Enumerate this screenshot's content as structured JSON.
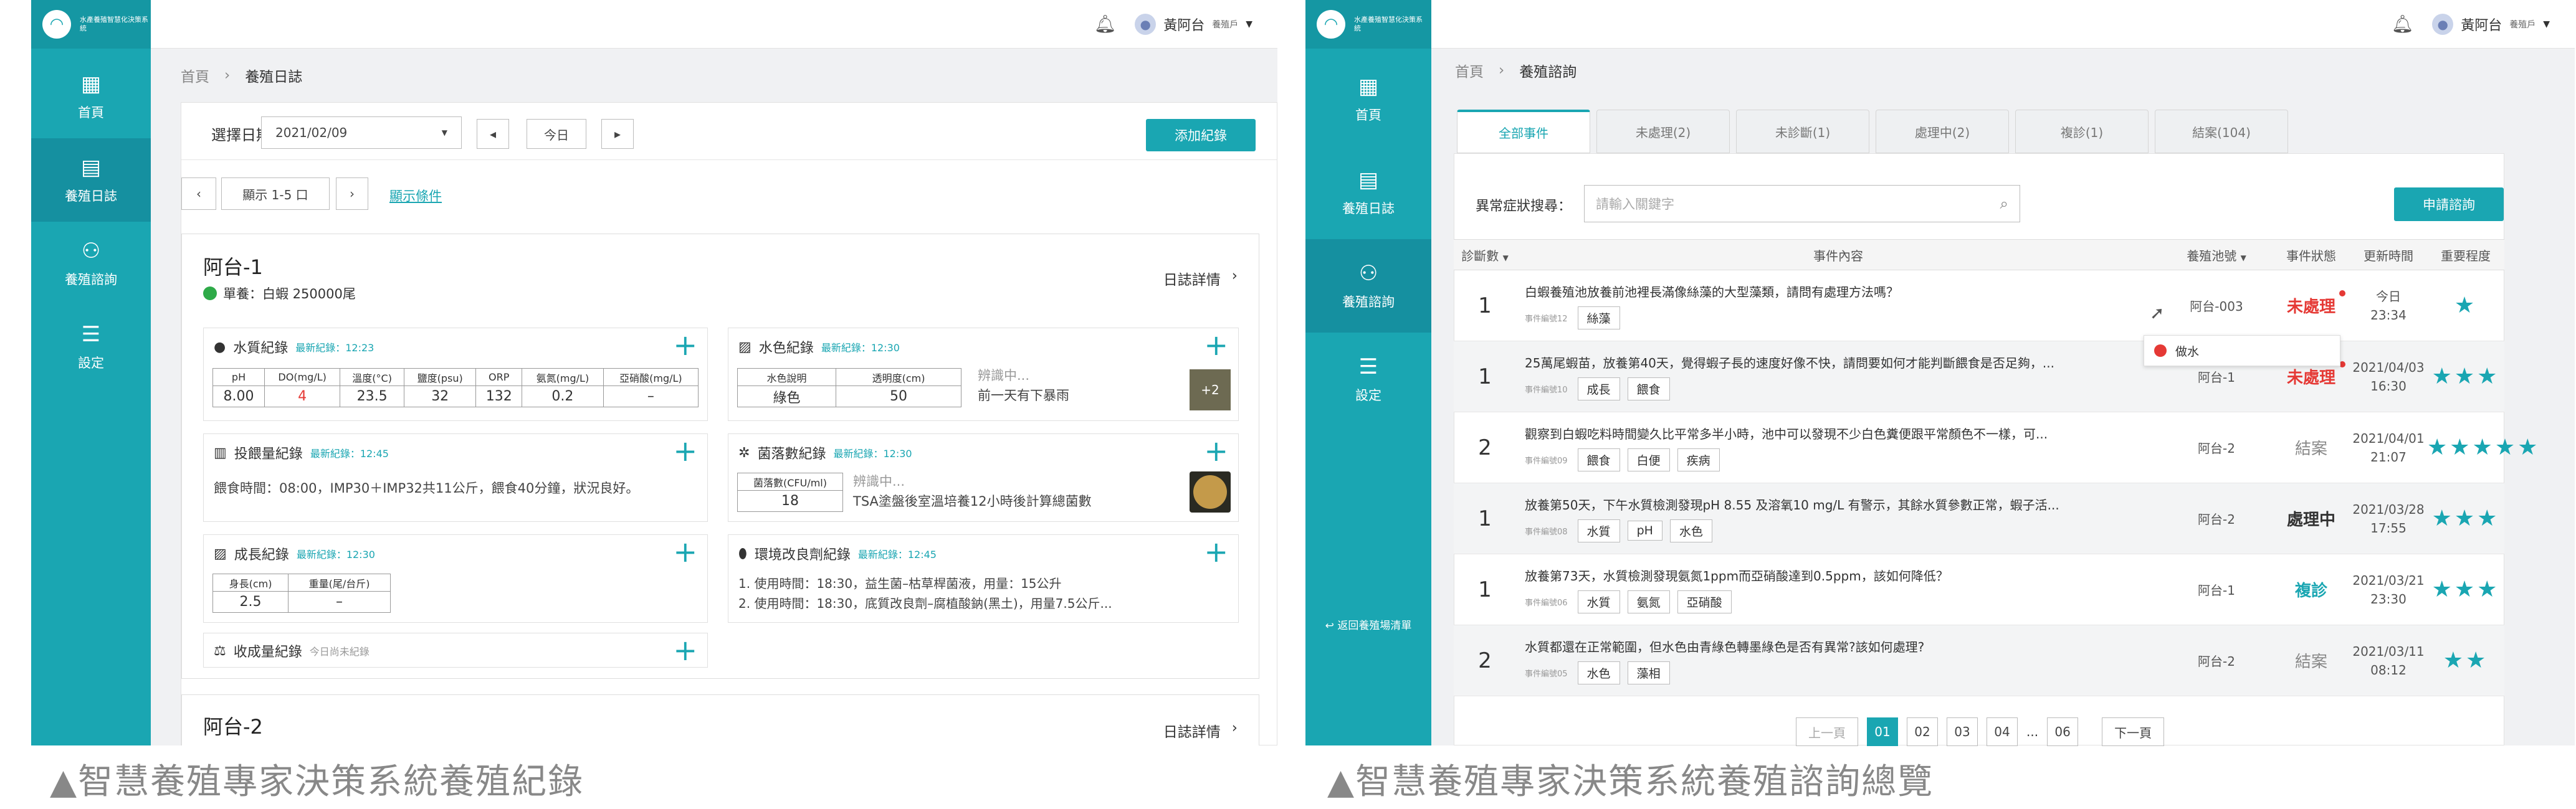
{
  "logo_text": "水產養殖智慧化決策系統",
  "p1": {
    "nav": [
      {
        "label": "首頁",
        "icon": "dashboard-icon"
      },
      {
        "label": "養殖日誌",
        "icon": "log-icon"
      },
      {
        "label": "養殖諮詢",
        "icon": "consult-icon"
      },
      {
        "label": "設定",
        "icon": "settings-icon"
      }
    ],
    "user": {
      "name": "黃阿台",
      "role": "養殖戶"
    },
    "breadcrumb": {
      "home": "首頁",
      "current": "養殖日誌"
    },
    "date_label": "選擇日期：",
    "date_value": "2021/02/09",
    "today": "今日",
    "add": "添加紀錄",
    "show": "顯示 1-5 口",
    "filter": "顯示條件",
    "pond1": {
      "name": "阿台-1",
      "species": "單養：白蝦 250000尾",
      "detail": "日誌詳情"
    },
    "pond2": {
      "name": "阿台-2",
      "detail": "日誌詳情"
    },
    "water": {
      "title": "水質紀錄",
      "latest": "最新紀錄：12:23",
      "headers": [
        "pH",
        "DO(mg/L)",
        "溫度(°C)",
        "鹽度(psu)",
        "ORP",
        "氨氮(mg/L)",
        "亞硝酸(mg/L)"
      ],
      "values": [
        "8.00",
        "4",
        "23.5",
        "32",
        "132",
        "0.2",
        "–"
      ]
    },
    "color": {
      "title": "水色紀錄",
      "latest": "最新紀錄：12:30",
      "headers": [
        "水色說明",
        "透明度(cm)"
      ],
      "values": [
        "綠色",
        "50"
      ],
      "recog": "辨識中...",
      "note": "前一天有下暴雨",
      "more": "+2"
    },
    "feed": {
      "title": "投餵量紀錄",
      "latest": "最新紀錄：12:45",
      "text": "餵食時間：08:00，IMP30＋IMP32共11公斤，餵食40分鐘，狀況良好。"
    },
    "bact": {
      "title": "菌落數紀錄",
      "latest": "最新紀錄：12:30",
      "header": "菌落數(CFU/ml)",
      "value": "18",
      "recog": "辨識中...",
      "note": "TSA塗盤後室溫培養12小時後計算總菌數"
    },
    "growth": {
      "title": "成長紀錄",
      "latest": "最新紀錄：12:30",
      "headers": [
        "身長(cm)",
        "重量(尾/台斤)"
      ],
      "values": [
        "2.5",
        "–"
      ]
    },
    "env": {
      "title": "環境改良劑紀錄",
      "latest": "最新紀錄：12:45",
      "lines": [
        "1. 使用時間：18:30，益生菌–枯草桿菌液，用量：15公升",
        "2. 使用時間：18:30，底質改良劑–腐植酸鈉(黑土)，用量7.5公斤..."
      ]
    },
    "harvest": {
      "title": "收成量紀錄",
      "latest": "今日尚未紀錄"
    }
  },
  "p2": {
    "nav": [
      {
        "label": "首頁",
        "icon": "dashboard-icon"
      },
      {
        "label": "養殖日誌",
        "icon": "log-icon"
      },
      {
        "label": "養殖諮詢",
        "icon": "consult-icon"
      },
      {
        "label": "設定",
        "icon": "settings-icon"
      }
    ],
    "back": "返回養殖場清單",
    "user": {
      "name": "黃阿台",
      "role": "養殖戶"
    },
    "breadcrumb": {
      "home": "首頁",
      "current": "養殖諮詢"
    },
    "tabs": [
      "全部事件",
      "未處理(2)",
      "未診斷(1)",
      "處理中(2)",
      "複診(1)",
      "結案(104)"
    ],
    "search_label": "異常症狀搜尋：",
    "search_placeholder": "請輸入關鍵字",
    "apply": "申請諮詢",
    "cols": [
      "診斷數",
      "事件內容",
      "養殖池號",
      "事件狀態",
      "更新時間",
      "重要程度"
    ],
    "rows": [
      {
        "count": "1",
        "title": "白蝦養殖池放養前池裡長滿像絲藻的大型藻類，請問有處理方法嗎？",
        "no": "事件編號12",
        "tags": [
          "絲藻"
        ],
        "pond": "阿台-003",
        "status": "未處理",
        "sc": "#e53935",
        "t1": "今日",
        "t2": "23:34",
        "stars": "★"
      },
      {
        "count": "1",
        "title": "25萬尾蝦苗，放養第40天，覺得蝦子長的速度好像不快，請問要如何才能判斷餵食是否足夠，...",
        "no": "事件編號10",
        "tags": [
          "成長",
          "餵食"
        ],
        "pond": "阿台-1",
        "status": "未處理",
        "sc": "#e53935",
        "t1": "2021/04/03",
        "t2": "16:30",
        "stars": "★★★"
      },
      {
        "count": "2",
        "title": "觀察到白蝦吃料時間變久比平常多半小時，池中可以發現不少白色糞便跟平常顏色不一樣，可...",
        "no": "事件編號09",
        "tags": [
          "餵食",
          "白便",
          "疾病"
        ],
        "pond": "阿台-2",
        "status": "結案",
        "sc": "#888",
        "t1": "2021/04/01",
        "t2": "21:07",
        "stars": "★★★★★"
      },
      {
        "count": "1",
        "title": "放養第50天，下午水質檢測發現pH 8.55 及溶氧10 mg/L 有警示，其餘水質參數正常，蝦子活...",
        "no": "事件編號08",
        "tags": [
          "水質",
          "pH",
          "水色"
        ],
        "pond": "阿台-2",
        "status": "處理中",
        "sc": "#333",
        "t1": "2021/03/28",
        "t2": "17:55",
        "stars": "★★★"
      },
      {
        "count": "1",
        "title": "放養第73天，水質檢測發現氨氮1ppm而亞硝酸達到0.5ppm，該如何降低？",
        "no": "事件編號06",
        "tags": [
          "水質",
          "氨氮",
          "亞硝酸"
        ],
        "pond": "阿台-1",
        "status": "複診",
        "sc": "#1aa6b2",
        "t1": "2021/03/21",
        "t2": "23:30",
        "stars": "★★★"
      },
      {
        "count": "2",
        "title": "水質都還在正常範圍，但水色由青綠色轉墨綠色是否有異常?該如何處理?",
        "no": "事件編號05",
        "tags": [
          "水色",
          "藻相"
        ],
        "pond": "阿台-2",
        "status": "結案",
        "sc": "#888",
        "t1": "2021/03/11",
        "t2": "08:12",
        "stars": "★★"
      }
    ],
    "tooltip": "做水",
    "pager": {
      "prev": "上一頁",
      "pages": [
        "01",
        "02",
        "03",
        "04",
        "...",
        "06"
      ],
      "next": "下一頁"
    }
  },
  "captions": [
    "▲智慧養殖專家決策系統養殖紀錄",
    "▲智慧養殖專家決策系統養殖諮詢總覽"
  ]
}
